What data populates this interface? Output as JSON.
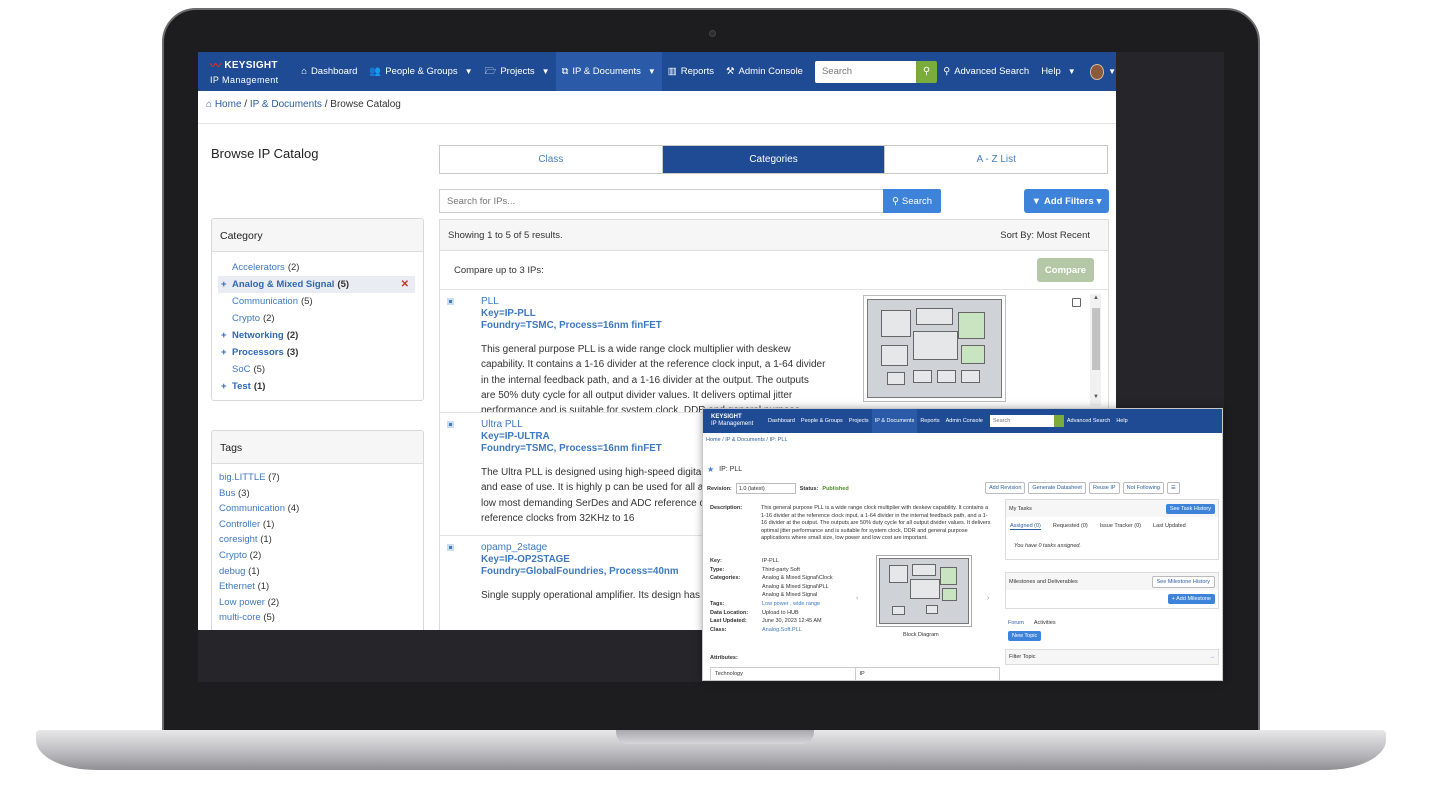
{
  "nav": {
    "brand": "KEYSIGHT",
    "brand_sub": "IP Management",
    "items": [
      {
        "label": "Dashboard",
        "icon": "home-icon",
        "caret": false
      },
      {
        "label": "People & Groups",
        "icon": "users-icon",
        "caret": true
      },
      {
        "label": "Projects",
        "icon": "folder-icon",
        "caret": true
      },
      {
        "label": "IP & Documents",
        "icon": "documents-icon",
        "caret": true
      },
      {
        "label": "Reports",
        "icon": "bar-chart-icon",
        "caret": false
      },
      {
        "label": "Admin Console",
        "icon": "tools-icon",
        "caret": false
      }
    ],
    "search_placeholder": "Search",
    "advanced_search": "Advanced Search",
    "help": "Help"
  },
  "breadcrumb": {
    "home": "Home",
    "section": "IP & Documents",
    "current": "Browse Catalog"
  },
  "page_title": "Browse IP Catalog",
  "category_panel": {
    "title": "Category",
    "items": [
      {
        "label": "Accelerators",
        "count": "(2)",
        "bold": false,
        "expand": false,
        "selected": false
      },
      {
        "label": "Analog & Mixed Signal",
        "count": "(5)",
        "bold": true,
        "expand": true,
        "selected": true
      },
      {
        "label": "Communication",
        "count": "(5)",
        "bold": false,
        "expand": false,
        "selected": false
      },
      {
        "label": "Crypto",
        "count": "(2)",
        "bold": false,
        "expand": false,
        "selected": false
      },
      {
        "label": "Networking",
        "count": "(2)",
        "bold": true,
        "expand": true,
        "selected": false
      },
      {
        "label": "Processors",
        "count": "(3)",
        "bold": true,
        "expand": true,
        "selected": false
      },
      {
        "label": "SoC",
        "count": "(5)",
        "bold": false,
        "expand": false,
        "selected": false
      },
      {
        "label": "Test",
        "count": "(1)",
        "bold": true,
        "expand": true,
        "selected": false
      }
    ]
  },
  "tags_panel": {
    "title": "Tags",
    "items": [
      {
        "label": "big.LITTLE",
        "count": "(7)"
      },
      {
        "label": "Bus",
        "count": "(3)"
      },
      {
        "label": "Communication",
        "count": "(4)"
      },
      {
        "label": "Controller",
        "count": "(1)"
      },
      {
        "label": "coresight",
        "count": "(1)"
      },
      {
        "label": "Crypto",
        "count": "(2)"
      },
      {
        "label": "debug",
        "count": "(1)"
      },
      {
        "label": "Ethernet",
        "count": "(1)"
      },
      {
        "label": "Low power",
        "count": "(2)"
      },
      {
        "label": "multi-core",
        "count": "(5)"
      }
    ]
  },
  "tabs": [
    {
      "label": "Class",
      "active": false
    },
    {
      "label": "Categories",
      "active": true
    },
    {
      "label": "A - Z List",
      "active": false
    }
  ],
  "ip_search": {
    "placeholder": "Search for IPs...",
    "button": "Search",
    "filters": "Add Filters"
  },
  "results": {
    "summary": "Showing 1 to 5 of 5 results.",
    "sort": "Sort By: Most Recent",
    "compare_text": "Compare up to 3 IPs:",
    "compare_button": "Compare",
    "items": [
      {
        "name": "PLL",
        "key": "Key=IP-PLL",
        "foundry": "Foundry=TSMC, Process=16nm finFET",
        "description": "This general purpose PLL is a wide range clock multiplier with deskew capability. It contains a 1-16 divider at the reference clock input, a 1-64 divider in the internal feedback path, and a 1-16 divider at the output. The outputs are 50% duty cycle for all output divider values. It delivers optimal jitter performance and is suitable for system clock, DDR and general purpose"
      },
      {
        "name": "Ultra PLL",
        "key": "Key=IP-ULTRA",
        "foundry": "Foundry=TSMC, Process=16nm finFET",
        "description": "The Ultra PLL is designed using high-speed digital a performance, features and ease of use. It is highly p can be used for all applications on a SoC. It has low most demanding SerDes and ADC reference clocks. range to support reference clocks from 32KHz to 16"
      },
      {
        "name": "opamp_2stage",
        "key": "Key=IP-OP2STAGE",
        "foundry": "Foundry=GlobalFoundries, Process=40nm",
        "description": "Single supply operational amplifier. Its design has b supply operation"
      }
    ]
  },
  "detail": {
    "brand": "KEYSIGHT",
    "brand_sub": "IP Management",
    "nav": [
      "Dashboard",
      "People & Groups",
      "Projects",
      "IP & Documents",
      "Reports",
      "Admin Console"
    ],
    "search_placeholder": "Search",
    "advanced_search": "Advanced Search",
    "help": "Help",
    "breadcrumb": "Home / IP & Documents / IP: PLL",
    "title": "IP: PLL",
    "revision_label": "Revision:",
    "revision_value": "1.0 (latest)",
    "status_label": "Status:",
    "status_value": "Published",
    "actions": [
      "Add Revision",
      "Generate Datasheet",
      "Reuse IP",
      "Not Following"
    ],
    "description_label": "Description:",
    "description": "This general purpose PLL is a wide range clock multiplier with deskew capability. It contains a 1-16 divider at the reference clock input, a 1-64 divider in the internal feedback path, and a 1-16 divider at the output. The outputs are 50% duty cycle for all output divider values. It delivers optimal jitter performance and is suitable for system clock, DDR and general purpose applications where small size, low power and low cost are important.",
    "fields": [
      {
        "k": "Key:",
        "v": "IP-PLL",
        "link": false
      },
      {
        "k": "Type:",
        "v": "Third-party Soft",
        "link": false
      },
      {
        "k": "Categories:",
        "v": "Analog & Mixed Signal\\Clock",
        "link": false
      },
      {
        "k": "",
        "v": "Analog & Mixed Signal\\PLL",
        "link": false
      },
      {
        "k": "",
        "v": "Analog & Mixed Signal",
        "link": false
      },
      {
        "k": "Tags:",
        "v": "Low power , wide range",
        "link": true
      },
      {
        "k": "Data Location:",
        "v": "Upload to HUB",
        "link": false
      },
      {
        "k": "Last Updated:",
        "v": "June 30, 2023 12:45 AM",
        "link": false
      },
      {
        "k": "Class:",
        "v": "Analog.Soft.PLL",
        "link": true
      }
    ],
    "diagram_label": "Block Diagram",
    "attributes_label": "Attributes:",
    "attr_row": [
      "Technology",
      "IP"
    ],
    "tasks_title": "My Tasks",
    "tasks_button": "See Task History",
    "task_tabs": [
      "Assigned (0)",
      "Requested (0)",
      "Issue Tracker (0)",
      "Last Updated"
    ],
    "tasks_note": "You have 0 tasks assigned.",
    "milestones_title": "Milestones and Deliverables",
    "milestones_button": "See Milestone History",
    "add_milestone": "+ Add Milestone",
    "forum_tabs": [
      "Forum",
      "Activities"
    ],
    "new_topic": "New Topic",
    "filter_topic": "Filter Topic"
  }
}
